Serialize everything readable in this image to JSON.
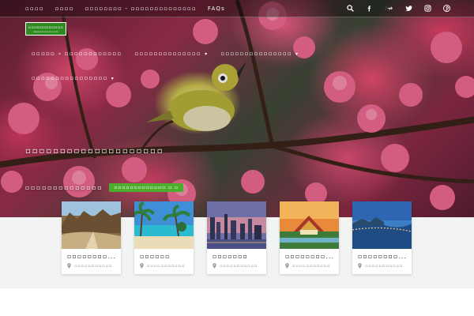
{
  "topbar": {
    "links": [
      "▫▫▫▫",
      "▫▫▫▫",
      "▫▫▫▫▫▫▫▫ - ▫▫▫▫▫▫▫▫▫▫▫▫▫▫",
      "FAQs"
    ],
    "icons": [
      "search-icon",
      "facebook-icon",
      "google-plus-icon",
      "twitter-icon",
      "instagram-icon",
      "pinterest-icon"
    ]
  },
  "logo": {
    "title": "▫▫▫▫▫▫▫▫▫▫▫▫",
    "subtitle": "www.▫▫▫▫▫▫▫▫.com"
  },
  "nav": {
    "items": [
      {
        "label": "▫▫▫▫▫ - ▫▫▫▫▫▫▫▫▫▫▫▫",
        "dropdown": false
      },
      {
        "label": "▫▫▫▫▫▫▫▫▫▫▫▫▫▫",
        "dropdown": true
      },
      {
        "label": "▫▫▫▫▫▫▫▫▫▫▫▫▫▫▫",
        "dropdown": true
      },
      {
        "label": "▫▫▫▫▫▫▫▫▫▫▫▫▫▫▫▫",
        "dropdown": true
      }
    ],
    "caret": "▾"
  },
  "hero": {
    "headline": "▫▫▫▫▫▫▫▫▫▫▫▫▫▫▫▫▫▫▫▫",
    "subline": "▫▫▫▫▫▫▫▫▫▫▫▫▫▫",
    "cta": "▫▫▫▫▫▫▫▫▫▫▫▫▫ ▫ ▫"
  },
  "colors": {
    "accent_green": "#4cae2c",
    "logo_green": "#2f8a1f",
    "band_gray": "#f2f4f3"
  },
  "cards": [
    {
      "title": "▫▫▫▫▫▫▫▫...",
      "location": "▫▫▫▫▫▫▫▫▫▫▫",
      "icon": "map-pin-icon"
    },
    {
      "title": "▫▫▫▫▫▫",
      "location": "▫▫▫▫▫▫▫▫▫▫▫",
      "icon": "map-pin-icon"
    },
    {
      "title": "▫▫▫▫▫▫▫",
      "location": "▫▫▫▫▫▫▫▫▫▫▫",
      "icon": "map-pin-icon"
    },
    {
      "title": "▫▫▫▫▫▫▫▫...",
      "location": "▫▫▫▫▫▫▫▫▫▫▫",
      "icon": "map-pin-icon"
    },
    {
      "title": "▫▫▫▫▫▫▫▫...",
      "location": "▫▫▫▫▫▫▫▫▫▫▫",
      "icon": "map-pin-icon"
    }
  ]
}
